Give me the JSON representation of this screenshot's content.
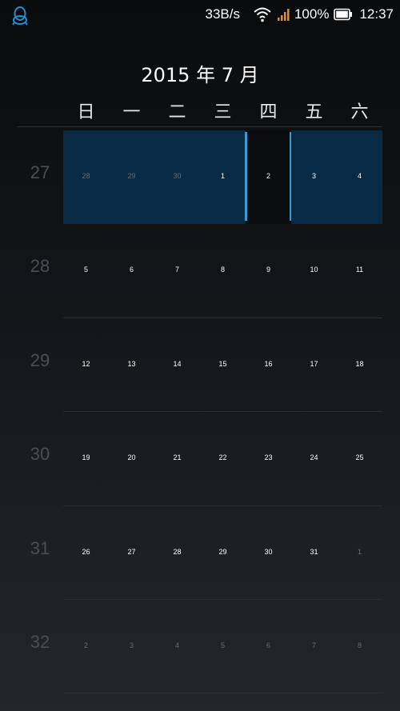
{
  "status_bar": {
    "app_icon": "qq-penguin-icon",
    "net_speed": "33B/s",
    "wifi_icon": "wifi-icon",
    "signal_icon": "signal-bars-icon",
    "battery_percent": "100%",
    "battery_icon": "battery-icon",
    "time": "12:37"
  },
  "calendar": {
    "month_title": "2015 年 7 月",
    "weekdays": [
      "日",
      "一",
      "二",
      "三",
      "四",
      "五",
      "六"
    ],
    "weeks": [
      {
        "number": "27",
        "days": [
          {
            "label": "28",
            "current_month": false
          },
          {
            "label": "29",
            "current_month": false
          },
          {
            "label": "30",
            "current_month": false
          },
          {
            "label": "1",
            "current_month": true
          },
          {
            "label": "2",
            "current_month": true,
            "today": true
          },
          {
            "label": "3",
            "current_month": true
          },
          {
            "label": "4",
            "current_month": true
          }
        ]
      },
      {
        "number": "28",
        "days": [
          {
            "label": "5",
            "current_month": true
          },
          {
            "label": "6",
            "current_month": true
          },
          {
            "label": "7",
            "current_month": true
          },
          {
            "label": "8",
            "current_month": true
          },
          {
            "label": "9",
            "current_month": true
          },
          {
            "label": "10",
            "current_month": true
          },
          {
            "label": "11",
            "current_month": true
          }
        ]
      },
      {
        "number": "29",
        "days": [
          {
            "label": "12",
            "current_month": true
          },
          {
            "label": "13",
            "current_month": true
          },
          {
            "label": "14",
            "current_month": true
          },
          {
            "label": "15",
            "current_month": true
          },
          {
            "label": "16",
            "current_month": true
          },
          {
            "label": "17",
            "current_month": true
          },
          {
            "label": "18",
            "current_month": true
          }
        ]
      },
      {
        "number": "30",
        "days": [
          {
            "label": "19",
            "current_month": true
          },
          {
            "label": "20",
            "current_month": true
          },
          {
            "label": "21",
            "current_month": true
          },
          {
            "label": "22",
            "current_month": true
          },
          {
            "label": "23",
            "current_month": true
          },
          {
            "label": "24",
            "current_month": true
          },
          {
            "label": "25",
            "current_month": true
          }
        ]
      },
      {
        "number": "31",
        "days": [
          {
            "label": "26",
            "current_month": true
          },
          {
            "label": "27",
            "current_month": true
          },
          {
            "label": "28",
            "current_month": true
          },
          {
            "label": "29",
            "current_month": true
          },
          {
            "label": "30",
            "current_month": true
          },
          {
            "label": "31",
            "current_month": true
          },
          {
            "label": "1",
            "current_month": false
          }
        ]
      },
      {
        "number": "32",
        "days": [
          {
            "label": "2",
            "current_month": false
          },
          {
            "label": "3",
            "current_month": false
          },
          {
            "label": "4",
            "current_month": false
          },
          {
            "label": "5",
            "current_month": false
          },
          {
            "label": "6",
            "current_month": false
          },
          {
            "label": "7",
            "current_month": false
          },
          {
            "label": "8",
            "current_month": false
          }
        ]
      }
    ]
  },
  "colors": {
    "selected_week_bg": "#082a44",
    "today_marker": "#3a9bd0",
    "week_number": "#4b4f55",
    "other_month_text": "#6b6f75",
    "app_icon": "#1f8fd6",
    "signal": "#f08a1c"
  }
}
